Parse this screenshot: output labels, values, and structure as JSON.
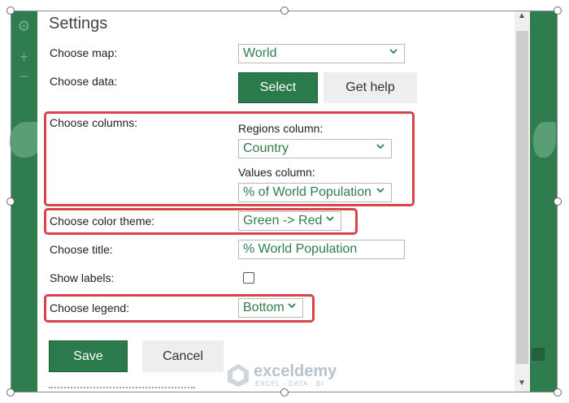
{
  "settings": {
    "title": "Settings",
    "choose_map_label": "Choose map:",
    "map_value": "World",
    "choose_data_label": "Choose data:",
    "select_button": "Select",
    "help_button": "Get help",
    "choose_columns_label": "Choose columns:",
    "regions_column_label": "Regions column:",
    "regions_value": "Country",
    "values_column_label": "Values column:",
    "values_value": "% of World Population",
    "color_theme_label": "Choose color theme:",
    "color_theme_value": "Green -> Red",
    "choose_title_label": "Choose title:",
    "title_value": "% World Population",
    "show_labels_label": "Show labels:",
    "show_labels_checked": false,
    "choose_legend_label": "Choose legend:",
    "legend_value": "Bottom",
    "save_button": "Save",
    "cancel_button": "Cancel"
  },
  "watermark": {
    "name": "exceldemy",
    "tagline": "EXCEL · DATA · BI"
  },
  "colors": {
    "accent_green": "#2b7a4b",
    "highlight_red": "#d9434b"
  },
  "icons": {
    "left_toolbar": [
      "gear-icon",
      "plus-icon",
      "minus-icon"
    ],
    "dropdown": "chevron-down-icon"
  }
}
